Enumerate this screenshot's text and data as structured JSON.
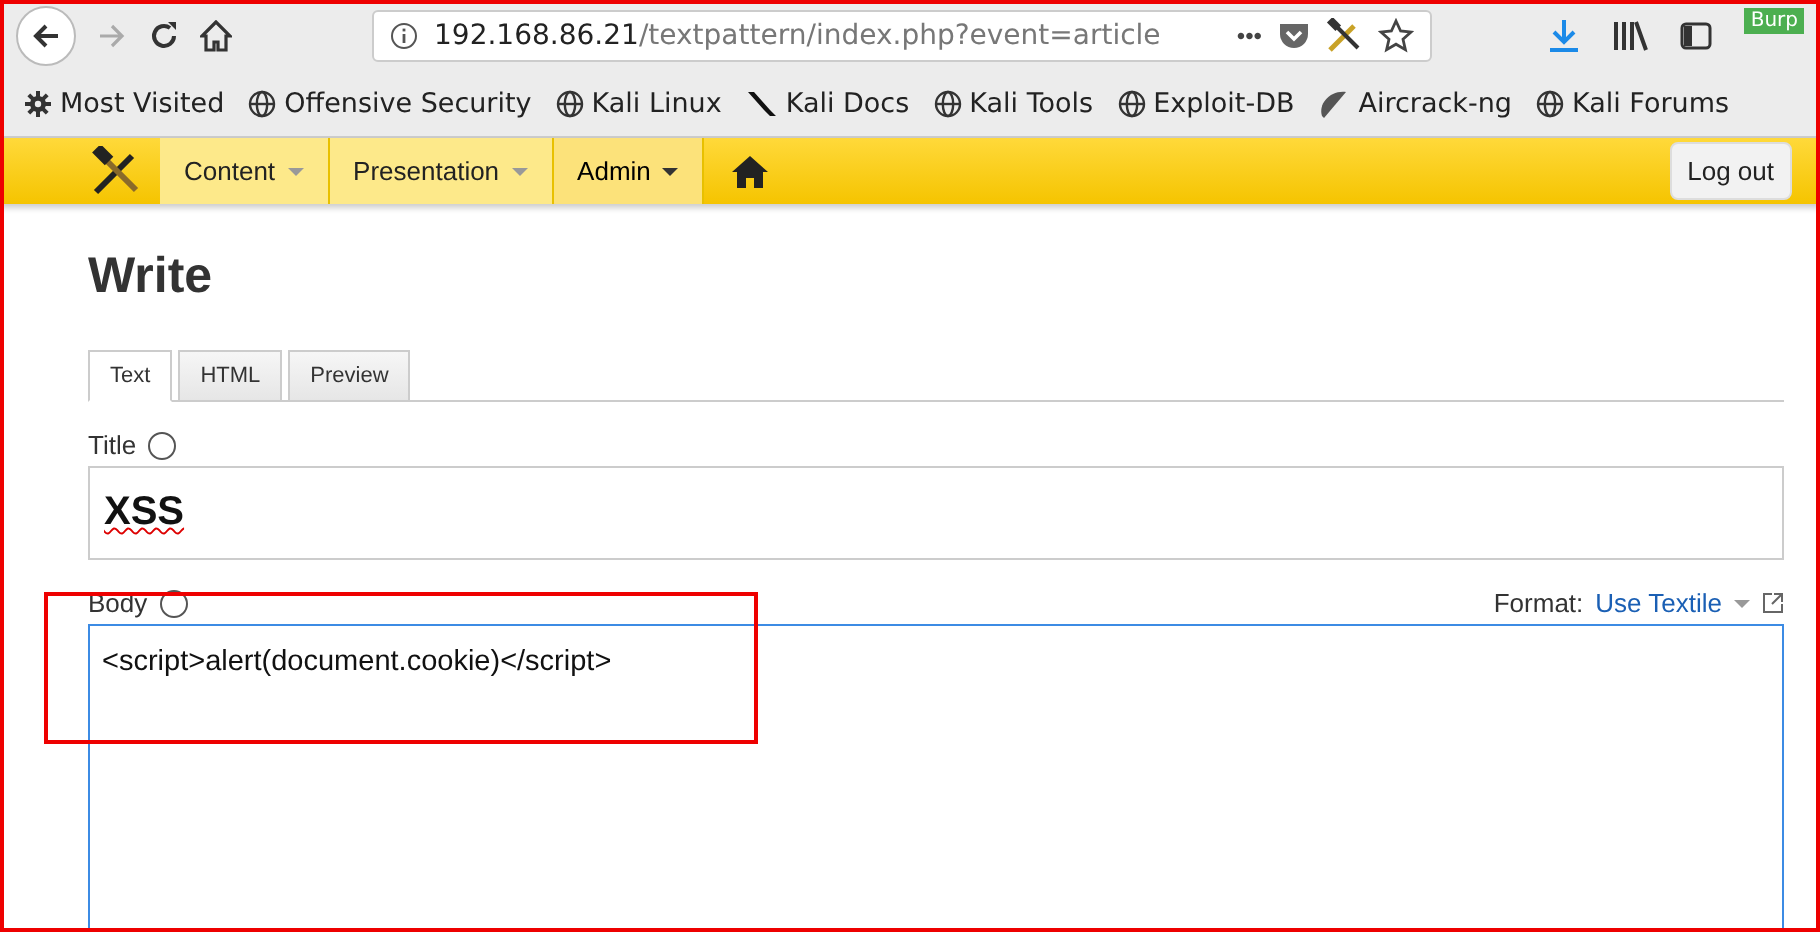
{
  "browser": {
    "url_host": "192.168.86.21",
    "url_path": "/textpattern/index.php?event=article",
    "overflow": "•••",
    "badge": "Burp"
  },
  "bookmarks": [
    {
      "label": "Most Visited",
      "kind": "gear"
    },
    {
      "label": "Offensive Security",
      "kind": "globe"
    },
    {
      "label": "Kali Linux",
      "kind": "globe"
    },
    {
      "label": "Kali Docs",
      "kind": "tool"
    },
    {
      "label": "Kali Tools",
      "kind": "globe"
    },
    {
      "label": "Exploit-DB",
      "kind": "globe"
    },
    {
      "label": "Aircrack-ng",
      "kind": "dish"
    },
    {
      "label": "Kali Forums",
      "kind": "globe"
    }
  ],
  "nav": {
    "items": [
      {
        "label": "Content",
        "selected": false
      },
      {
        "label": "Presentation",
        "selected": false
      },
      {
        "label": "Admin",
        "selected": true
      }
    ],
    "logout": "Log out"
  },
  "page": {
    "heading": "Write",
    "tabs": [
      {
        "label": "Text",
        "selected": true
      },
      {
        "label": "HTML",
        "selected": false
      },
      {
        "label": "Preview",
        "selected": false
      }
    ],
    "title_label": "Title",
    "title_value": "XSS",
    "body_label": "Body",
    "format_label": "Format:",
    "format_value": "Use Textile",
    "body_value": "<script>alert(document.cookie)</script>"
  }
}
